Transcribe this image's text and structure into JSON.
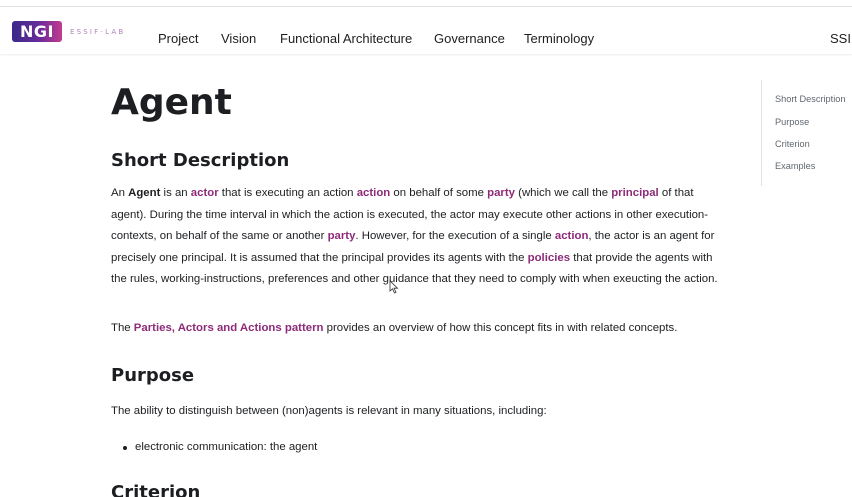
{
  "nav": {
    "logo_text": "NGI",
    "logo_sub": "ESSIF-LAB",
    "items": [
      "Project",
      "Vision",
      "Functional Architecture",
      "Governance",
      "Terminology"
    ],
    "right_item": "SSI"
  },
  "page": {
    "title": "Agent",
    "short_description": {
      "heading": "Short Description",
      "p1": [
        "An ",
        {
          "b": "Agent"
        },
        " is an ",
        {
          "a": "actor"
        },
        " that is executing an action ",
        {
          "a": "action"
        },
        " on behalf of some ",
        {
          "a": "party"
        },
        " (which we call the ",
        {
          "a": "principal"
        },
        " of that agent). During the time interval in which the action is executed, the actor may execute other actions in other execution-contexts, on behalf of the same or another ",
        {
          "a": "party"
        },
        ". However, for the execution of a single ",
        {
          "a": "action"
        },
        ", the actor is an agent for precisely one principal. It is assumed that the principal provides its agents with the ",
        {
          "a": "policies"
        },
        " that provide the agents with the rules, working-instructions, preferences and other guidance that they need to comply with when exeucting the action."
      ],
      "p2": [
        "The ",
        {
          "a": "Parties, Actors and Actions pattern"
        },
        " provides an overview of how this concept fits in with related concepts."
      ]
    },
    "purpose": {
      "heading": "Purpose",
      "text": "The ability to distinguish between (non)agents is relevant in many situations, including:",
      "bullets": [
        "electronic communication: the agent"
      ]
    },
    "criterion": {
      "heading": "Criterion"
    }
  },
  "toc": [
    "Short Description",
    "Purpose",
    "Criterion",
    "Examples"
  ],
  "colors": {
    "link": "#8e2b79",
    "text": "#1c1e21",
    "logo_start": "#3a2a8a",
    "logo_end": "#c23b8f"
  }
}
